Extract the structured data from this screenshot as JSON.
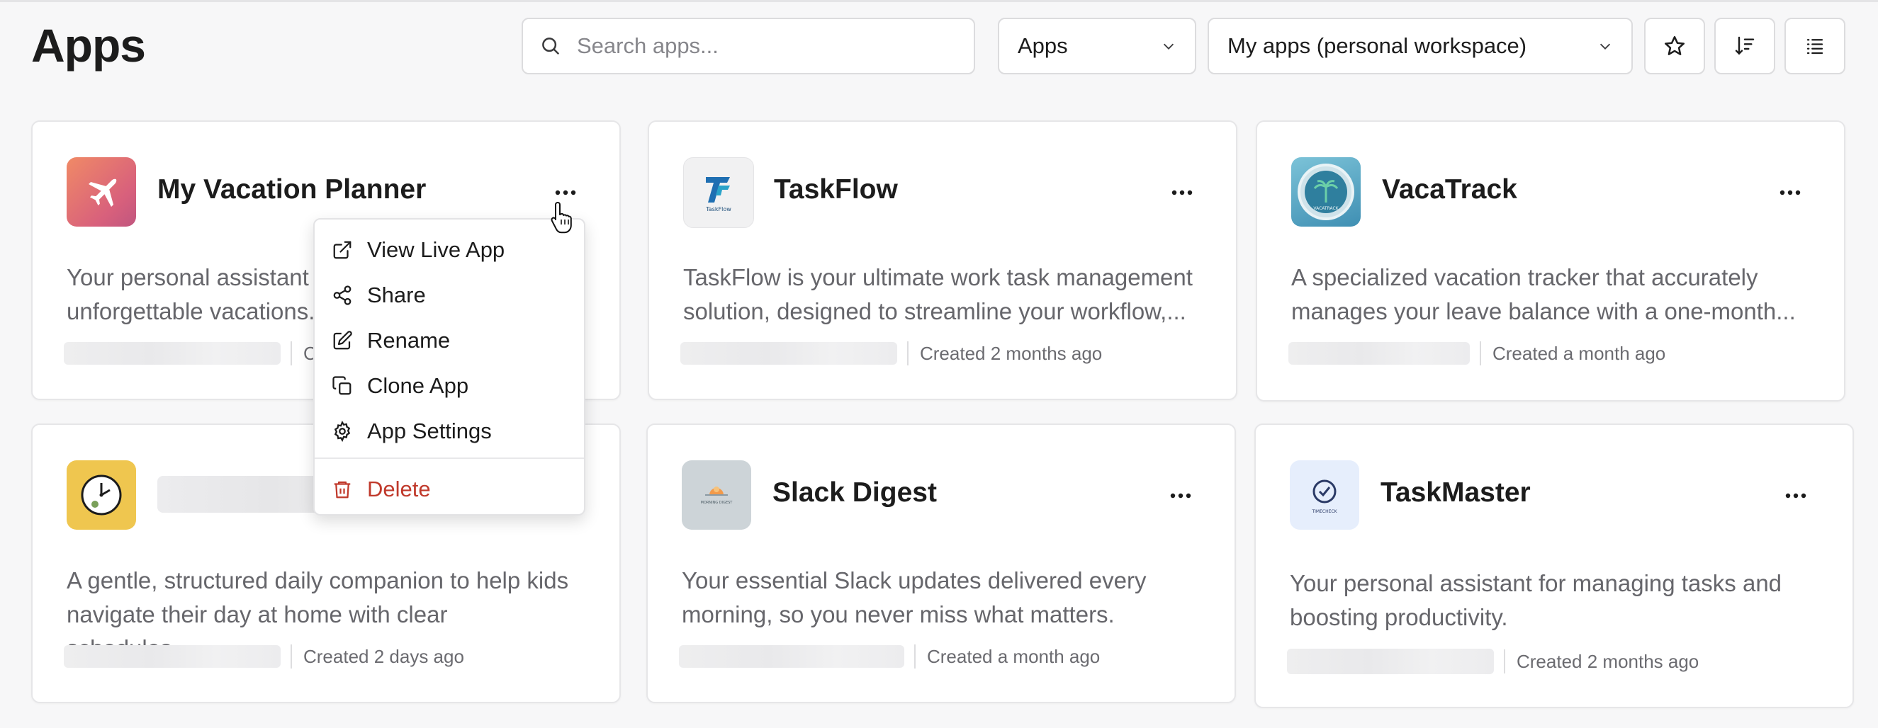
{
  "header": {
    "title": "Apps",
    "search_placeholder": "Search apps...",
    "type_filter": "Apps",
    "workspace_filter": "My apps (personal workspace)",
    "buttons": [
      "star-icon",
      "sort-icon",
      "list-view-icon"
    ]
  },
  "apps": [
    {
      "name": "My Vacation Planner",
      "description_line1": "Your personal assistant f",
      "description_line2": "unforgettable vacations.",
      "created": "C",
      "icon": "airplane-icon",
      "icon_color": "#e5727a"
    },
    {
      "name": "TaskFlow",
      "description_line1": "TaskFlow is your ultimate work task management",
      "description_line2": "solution, designed to streamline your workflow,...",
      "created": "Created 2 months ago",
      "icon": "taskflow-logo-icon",
      "icon_color": "#f2f2f3"
    },
    {
      "name": "VacaTrack",
      "description_line1": "A specialized vacation tracker that accurately",
      "description_line2": "manages your leave balance with a one-month...",
      "created": "Created a month ago",
      "icon": "vacatrack-logo-icon",
      "icon_color": "#5aa6c8"
    },
    {
      "name": "",
      "description_line1": "A gentle, structured daily companion to help kids",
      "description_line2": "navigate their day at home with clear schedules,...",
      "created": "Created 2 days ago",
      "icon": "clock-icon",
      "icon_color": "#efc64f"
    },
    {
      "name": "Slack Digest",
      "description_line1": "Your essential Slack updates delivered every",
      "description_line2": "morning, so you never miss what matters.",
      "created": "Created a month ago",
      "icon": "slack-digest-logo-icon",
      "icon_color": "#cfd6da"
    },
    {
      "name": "TaskMaster",
      "description_line1": "Your personal assistant for managing tasks and",
      "description_line2": "boosting productivity.",
      "created": "Created 2 months ago",
      "icon": "checkmark-badge-icon",
      "icon_color": "#e6eefc"
    }
  ],
  "context_menu": {
    "items": [
      "View Live App",
      "Share",
      "Rename",
      "Clone App",
      "App Settings"
    ],
    "delete": "Delete"
  }
}
